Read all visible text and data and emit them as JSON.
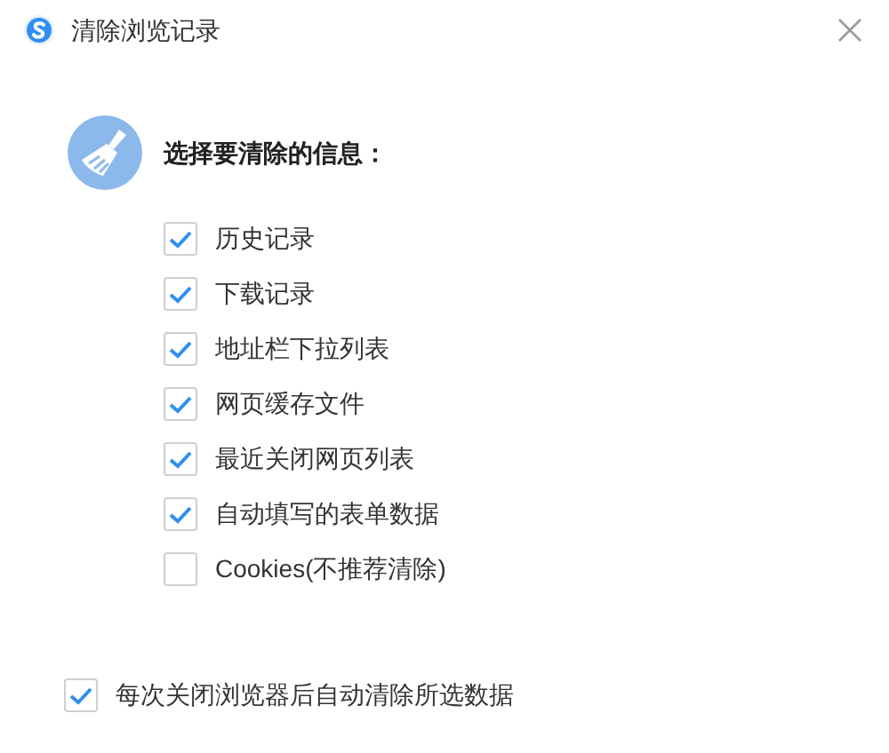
{
  "window": {
    "title": "清除浏览记录"
  },
  "heading": "选择要清除的信息：",
  "options": [
    {
      "label": "历史记录",
      "checked": true
    },
    {
      "label": "下载记录",
      "checked": true
    },
    {
      "label": "地址栏下拉列表",
      "checked": true
    },
    {
      "label": "网页缓存文件",
      "checked": true
    },
    {
      "label": "最近关闭网页列表",
      "checked": true
    },
    {
      "label": "自动填写的表单数据",
      "checked": true
    },
    {
      "label": "Cookies(不推荐清除)",
      "checked": false
    }
  ],
  "auto_clear": {
    "label": "每次关闭浏览器后自动清除所选数据",
    "checked": true
  }
}
